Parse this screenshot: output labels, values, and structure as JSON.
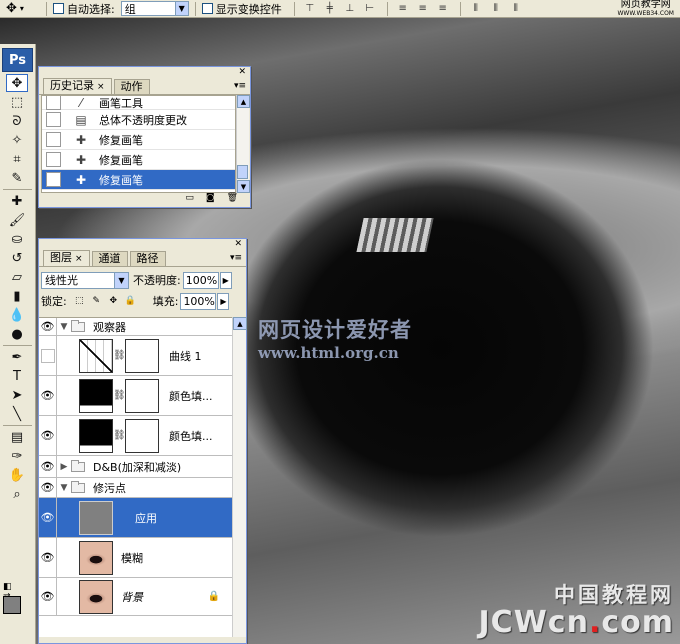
{
  "options_bar": {
    "auto_select_label": "自动选择:",
    "auto_select_value": "组",
    "show_transform_label": "显示变换控件"
  },
  "toolbox": {
    "logo": "Ps"
  },
  "history_panel": {
    "tabs": [
      {
        "label": "历史记录",
        "active": true
      },
      {
        "label": "动作",
        "active": false
      }
    ],
    "items": [
      {
        "label": "画笔工具",
        "icon": "brush-icon",
        "selected": false
      },
      {
        "label": "总体不透明度更改",
        "icon": "document-icon",
        "selected": false
      },
      {
        "label": "修复画笔",
        "icon": "bandage-icon",
        "selected": false
      },
      {
        "label": "修复画笔",
        "icon": "bandage-icon",
        "selected": false
      },
      {
        "label": "修复画笔",
        "icon": "bandage-icon",
        "selected": true
      }
    ]
  },
  "layers_panel": {
    "tabs": [
      {
        "label": "图层",
        "active": true
      },
      {
        "label": "通道",
        "active": false
      },
      {
        "label": "路径",
        "active": false
      }
    ],
    "blend_mode": "线性光",
    "opacity_label": "不透明度:",
    "opacity_value": "100%",
    "lock_label": "锁定:",
    "fill_label": "填充:",
    "fill_value": "100%",
    "layers": [
      {
        "name": "观察器",
        "kind": "group",
        "visible": true,
        "expanded": true,
        "selected": false
      },
      {
        "name": "曲线 1",
        "kind": "adjustment",
        "visible": false,
        "selected": false
      },
      {
        "name": "颜色填...",
        "kind": "fill",
        "visible": true,
        "selected": false
      },
      {
        "name": "颜色填...",
        "kind": "fill",
        "visible": true,
        "selected": false
      },
      {
        "name": "D&B(加深和减淡)",
        "kind": "group",
        "visible": true,
        "expanded": false,
        "selected": false
      },
      {
        "name": "修污点",
        "kind": "group",
        "visible": true,
        "expanded": true,
        "selected": false
      },
      {
        "name": "应用",
        "kind": "pixel",
        "visible": true,
        "selected": true
      },
      {
        "name": "模糊",
        "kind": "pixel",
        "visible": true,
        "selected": false
      },
      {
        "name": "背景",
        "kind": "background",
        "visible": true,
        "selected": false
      }
    ]
  },
  "watermarks": {
    "cn_title": "网页设计爱好者",
    "url": "www.html.org.cn",
    "top_right": "网页教学网",
    "top_right_small": "WWW.WEB34.COM",
    "site_cn": "中国教程网",
    "site_en_a": "JCWcn",
    "site_en_dot": ".",
    "site_en_b": "com"
  }
}
